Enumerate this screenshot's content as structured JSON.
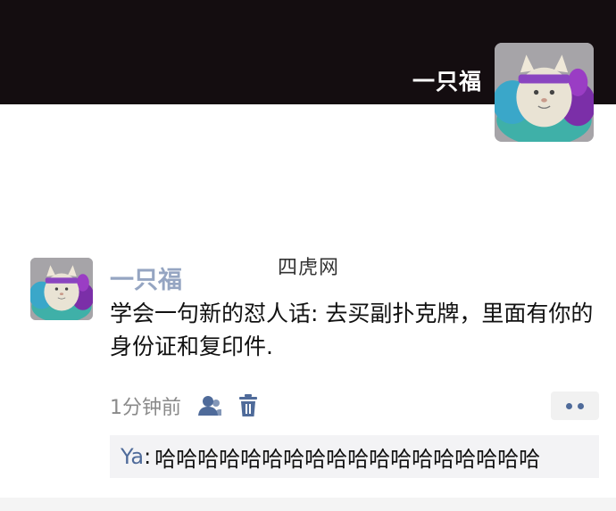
{
  "profile": {
    "name": "一只福"
  },
  "watermark": "四虎网",
  "post": {
    "author": "一只福",
    "text": "学会一句新的怼人话: 去买副扑克牌，里面有你的身份证和复印件.",
    "time": "1分钟前",
    "comment": {
      "user": "Ya",
      "separator": ":",
      "text": "哈哈哈哈哈哈哈哈哈哈哈哈哈哈哈哈哈哈"
    }
  },
  "icons": {
    "like": "person-icon",
    "delete": "trash-icon",
    "more": "more-dots-icon"
  },
  "colors": {
    "cover": "#140d10",
    "link_blue": "#4f6b9a",
    "comment_bg": "#f3f3f5"
  }
}
